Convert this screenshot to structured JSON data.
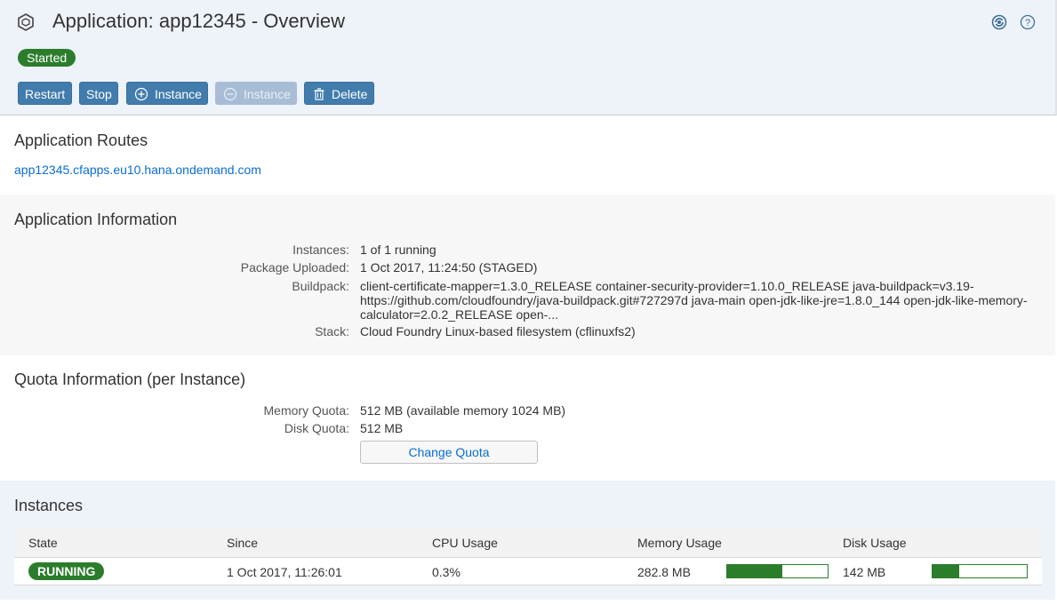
{
  "header": {
    "title": "Application: app12345 - Overview",
    "status": "Started",
    "icons": {
      "app": "app-cube-icon",
      "refresh": "sync-icon",
      "help": "help-icon"
    }
  },
  "toolbar": {
    "restart_label": "Restart",
    "stop_label": "Stop",
    "add_instance_label": "Instance",
    "remove_instance_label": "Instance",
    "delete_label": "Delete"
  },
  "routes": {
    "title": "Application Routes",
    "url": "app12345.cfapps.eu10.hana.ondemand.com"
  },
  "app_info": {
    "title": "Application Information",
    "instances_label": "Instances:",
    "instances_value": "1 of 1 running",
    "package_label": "Package Uploaded:",
    "package_value": "1 Oct 2017, 11:24:50 (STAGED)",
    "buildpack_label": "Buildpack:",
    "buildpack_value": "client-certificate-mapper=1.3.0_RELEASE container-security-provider=1.10.0_RELEASE java-buildpack=v3.19-https://github.com/cloudfoundry/java-buildpack.git#727297d java-main open-jdk-like-jre=1.8.0_144 open-jdk-like-memory-calculator=2.0.2_RELEASE open-...",
    "stack_label": "Stack:",
    "stack_value": "Cloud Foundry Linux-based filesystem (cflinuxfs2)"
  },
  "quota": {
    "title": "Quota Information (per Instance)",
    "memory_label": "Memory Quota:",
    "memory_value": "512 MB (available memory 1024 MB)",
    "disk_label": "Disk Quota:",
    "disk_value": "512 MB",
    "change_label": "Change Quota"
  },
  "instances": {
    "title": "Instances",
    "columns": [
      "State",
      "Since",
      "CPU Usage",
      "Memory Usage",
      "Disk Usage"
    ],
    "rows": [
      {
        "state": "RUNNING",
        "since": "1 Oct 2017, 11:26:01",
        "cpu": "0.3%",
        "memory": "282.8 MB",
        "memory_fraction": 0.55,
        "disk": "142 MB",
        "disk_fraction": 0.28
      }
    ]
  },
  "colors": {
    "accent": "#427cac",
    "success": "#2b7d2b",
    "link": "#0a6ed1"
  }
}
